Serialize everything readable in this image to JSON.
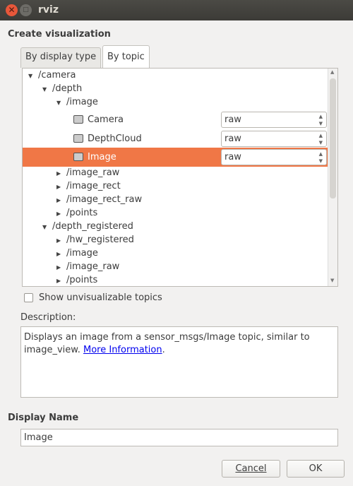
{
  "window": {
    "title": "rviz"
  },
  "section_title": "Create visualization",
  "tabs": [
    {
      "label": "By display type",
      "active": false
    },
    {
      "label": "By topic",
      "active": true
    }
  ],
  "tree": [
    {
      "label": "/camera",
      "level": 0,
      "expanded": true
    },
    {
      "label": "/depth",
      "level": 1,
      "expanded": true
    },
    {
      "label": "/image",
      "level": 2,
      "expanded": true
    },
    {
      "label": "Camera",
      "level": 3,
      "icon": "camera-icon",
      "combo": "raw"
    },
    {
      "label": "DepthCloud",
      "level": 3,
      "icon": "depthcloud-icon",
      "combo": "raw"
    },
    {
      "label": "Image",
      "level": 3,
      "icon": "image-icon",
      "combo": "raw",
      "selected": true
    },
    {
      "label": "/image_raw",
      "level": 2,
      "expanded": false
    },
    {
      "label": "/image_rect",
      "level": 2,
      "expanded": false
    },
    {
      "label": "/image_rect_raw",
      "level": 2,
      "expanded": false
    },
    {
      "label": "/points",
      "level": 2,
      "expanded": false
    },
    {
      "label": "/depth_registered",
      "level": 1,
      "expanded": true
    },
    {
      "label": "/hw_registered",
      "level": 2,
      "expanded": false
    },
    {
      "label": "/image",
      "level": 2,
      "expanded": false
    },
    {
      "label": "/image_raw",
      "level": 2,
      "expanded": false
    },
    {
      "label": "/points",
      "level": 2,
      "expanded": false
    }
  ],
  "show_unvisualizable": {
    "label": "Show unvisualizable topics",
    "checked": false
  },
  "description": {
    "label": "Description:",
    "text": "Displays an image from a sensor_msgs/Image topic, similar to image_view. ",
    "link": "More Information",
    "after": "."
  },
  "display_name": {
    "label": "Display Name",
    "value": "Image"
  },
  "buttons": {
    "cancel": "Cancel",
    "ok": "OK"
  },
  "colors": {
    "selection": "#f07746",
    "titlebar": "#3c3b37",
    "close": "#e8573a"
  }
}
